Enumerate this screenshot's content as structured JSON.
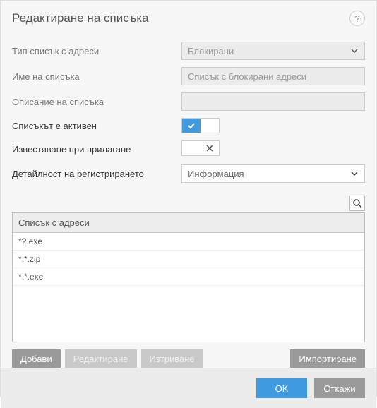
{
  "header": {
    "title": "Редактиране на списъка"
  },
  "form": {
    "type_label": "Тип списък с адреси",
    "type_value": "Блокирани",
    "name_label": "Име на списъка",
    "name_value": "Списък с блокирани адреси",
    "desc_label": "Описание на списъка",
    "desc_value": "",
    "active_label": "Списъкът е активен",
    "notify_label": "Известяване при прилагане",
    "verbosity_label": "Детайлност на регистрирането",
    "verbosity_value": "Информация"
  },
  "list": {
    "header": "Списък с адреси",
    "items": [
      "*?.exe",
      "*.*.zip",
      "*.*.exe"
    ]
  },
  "buttons": {
    "add": "Добави",
    "edit": "Редактиране",
    "delete": "Изтриване",
    "import": "Импортиране",
    "ok": "OK",
    "cancel": "Откажи"
  }
}
